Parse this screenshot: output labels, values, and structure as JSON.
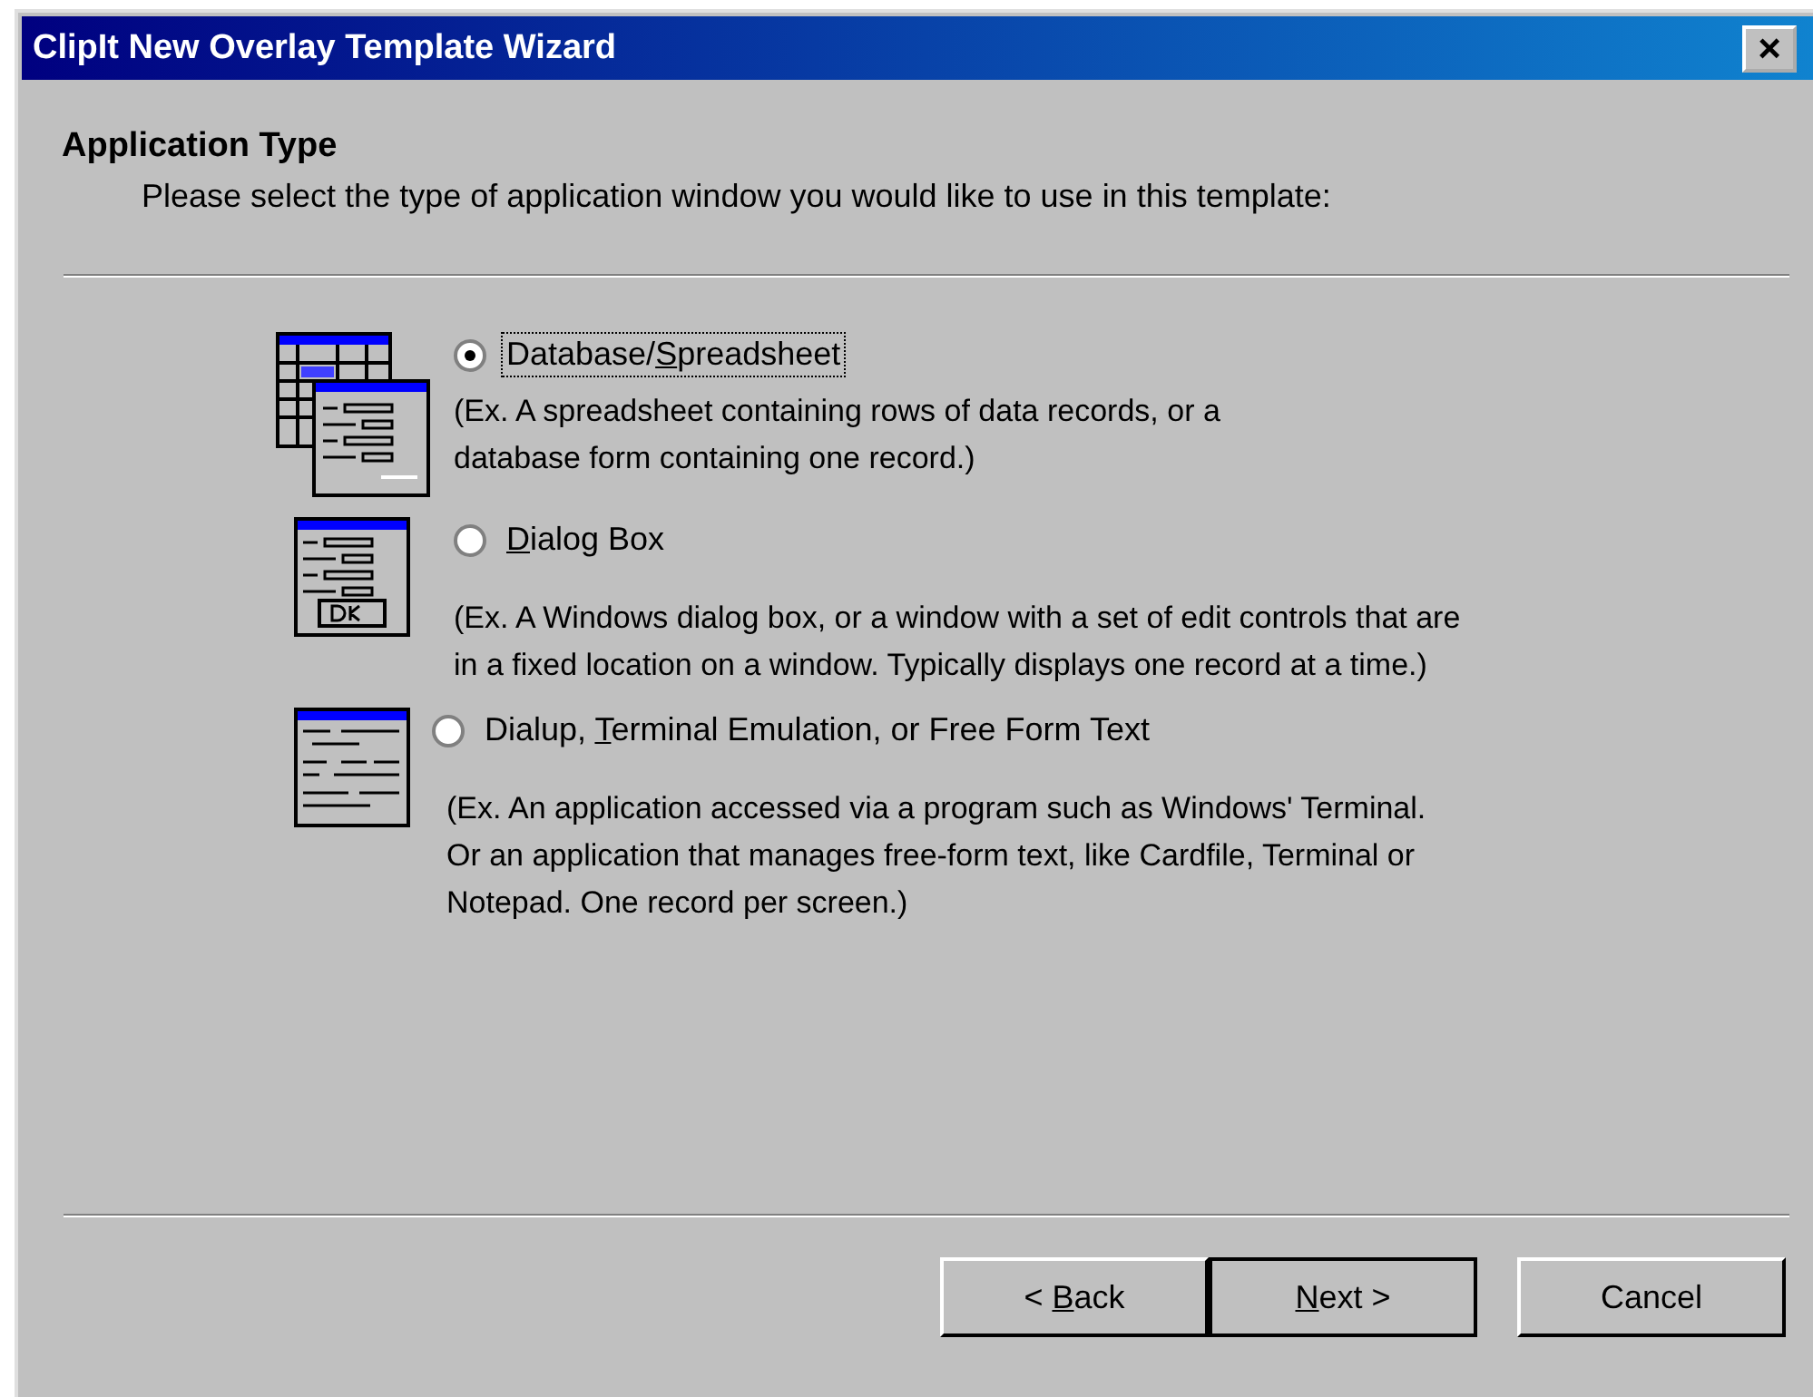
{
  "window": {
    "title": "ClipIt New Overlay Template Wizard",
    "close_label": "×"
  },
  "header": {
    "title": "Application Type",
    "subtitle": "Please select the type of application window you would like to use in this template:"
  },
  "options": [
    {
      "kind": "spreadsheet",
      "label": {
        "before": "Database/",
        "key": "S",
        "after": "preadsheet"
      },
      "selected": true,
      "focused": true,
      "description": "(Ex. A spreadsheet containing rows of data records, or a database form containing one record.)"
    },
    {
      "kind": "dialog",
      "label": {
        "key": "D",
        "after": "ialog Box"
      },
      "selected": false,
      "focused": false,
      "description": "(Ex. A Windows dialog box, or a window with a set of edit controls that are in a fixed location on a window. Typically displays one record at a time.)"
    },
    {
      "kind": "text",
      "label": {
        "before": "Dialup, ",
        "key": "T",
        "after": "erminal Emulation, or Free Form Text"
      },
      "selected": false,
      "focused": false,
      "description": "(Ex. An application accessed via a program such as Windows' Terminal. Or an application that manages free-form text, like Cardfile, Terminal or Notepad. One record per screen.)"
    }
  ],
  "buttons": [
    {
      "label": {
        "before": "< ",
        "key": "B",
        "after": "ack"
      },
      "default": false
    },
    {
      "label": {
        "key": "N",
        "after": "ext >"
      },
      "default": true
    },
    {
      "label": {
        "before": "Cancel"
      },
      "default": false
    }
  ]
}
